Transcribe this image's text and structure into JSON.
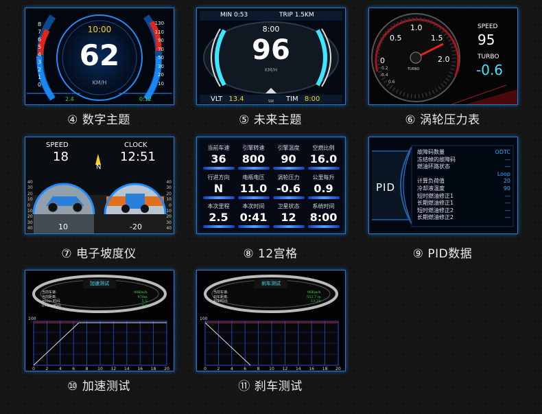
{
  "tiles": [
    {
      "caption": "④ 数字主题",
      "time": "10:00",
      "speed": "62",
      "unit": "KM/H",
      "left_val": "2.4",
      "right_val": "0:12",
      "left_ticks": [
        "8",
        "7",
        "6",
        "5",
        "4",
        "3",
        "2",
        "1",
        "0"
      ],
      "right_ticks": [
        "130",
        "110",
        "90",
        "70",
        "50",
        "30",
        "20",
        "10"
      ]
    },
    {
      "caption": "⑤ 未来主题",
      "min_label": "MIN",
      "min_val": "0:53",
      "trip_label": "TRIP",
      "trip_val": "1.5KM",
      "time": "8:00",
      "speed": "96",
      "unit": "KM/H",
      "vlt_label": "VLT",
      "vlt_val": "13.4",
      "tim_label": "TIM",
      "tim_val": "8:00",
      "compass": "SW"
    },
    {
      "caption": "⑥ 涡轮压力表",
      "gauge_labels": [
        "0.5",
        "1.0",
        "1.5",
        "2.0",
        "0",
        "0.2",
        "0.4",
        "0.6"
      ],
      "gauge_name": "TURBO",
      "speed_label": "SPEED",
      "speed_val": "95",
      "turbo_label": "TURBO",
      "turbo_val": "-0.6"
    },
    {
      "caption": "⑦ 电子坡度仪",
      "speed_label": "SPEED",
      "speed_val": "18",
      "clock_label": "CLOCK",
      "clock_val": "12:51",
      "compass": "N",
      "pitch": "10",
      "roll": "-20",
      "left_ticks": [
        "40",
        "30",
        "20",
        "10",
        "0",
        "10",
        "20",
        "30",
        "40"
      ],
      "right_ticks": [
        "40",
        "30",
        "20",
        "10",
        "0",
        "10",
        "20",
        "30",
        "40"
      ]
    },
    {
      "caption": "⑧ 12宫格",
      "cells": [
        {
          "label": "当前车速",
          "value": "36"
        },
        {
          "label": "引擎转速",
          "value": "800"
        },
        {
          "label": "引擎温度",
          "value": "90"
        },
        {
          "label": "空燃比例",
          "value": "16.0"
        },
        {
          "label": "行进方向",
          "value": "N"
        },
        {
          "label": "电瓶电压",
          "value": "11.0"
        },
        {
          "label": "涡轮压力",
          "value": "-0.6"
        },
        {
          "label": "公里每升",
          "value": "0.9"
        },
        {
          "label": "本次里程",
          "value": "2.5"
        },
        {
          "label": "本次时间",
          "value": "0:41"
        },
        {
          "label": "卫星状态",
          "value": "12"
        },
        {
          "label": "系统时间",
          "value": "8:00"
        }
      ]
    },
    {
      "caption": "⑨ PID数据",
      "pid_title": "PID",
      "rows": [
        {
          "k": "故障码数量",
          "v": "ODTC"
        },
        {
          "k": "冻结帧的故障码",
          "v": "---"
        },
        {
          "k": "燃油环路状态",
          "v": "---"
        },
        {
          "k": "",
          "v": "Loop"
        },
        {
          "k": "计算负荷值",
          "v": "20"
        },
        {
          "k": "冷却液温度",
          "v": "90"
        },
        {
          "k": "短时燃油修正1",
          "v": "---"
        },
        {
          "k": "长期燃油修正1",
          "v": "---"
        },
        {
          "k": "短时燃油修正2",
          "v": "---"
        },
        {
          "k": "长期燃油修正2",
          "v": "---"
        }
      ]
    },
    {
      "caption": "⑩ 加速测试",
      "title": "加速测试",
      "lines": [
        {
          "k": "当前车速:",
          "v": "98Km/h"
        },
        {
          "k": "当前距离:",
          "v": "470m"
        },
        {
          "k": "400m 时间:",
          "v": "5 S"
        },
        {
          "k": "0~100时间:",
          "v": "3 S"
        }
      ],
      "ymax": "100",
      "xticks": [
        "0",
        "2",
        "4",
        "6",
        "8",
        "10",
        "12",
        "14",
        "16",
        "18",
        "20"
      ]
    },
    {
      "caption": "⑪ 刹车测试",
      "title": "刹车测试",
      "lines": [
        {
          "k": "当前车速:",
          "v": "96Km/h"
        },
        {
          "k": "刹车距离:",
          "v": "553.7 m"
        },
        {
          "k": "刹车时间:",
          "v": "13.2S"
        }
      ],
      "ymax": "100",
      "xticks": [
        "0",
        "2",
        "4",
        "6",
        "8",
        "10",
        "12",
        "14",
        "16",
        "18",
        "20"
      ]
    }
  ],
  "colors": {
    "accent_blue": "#1e8cff",
    "cyan": "#3fe6ff",
    "red": "#e0261a",
    "yellow": "#ffd21a",
    "green": "#2edc4a"
  }
}
